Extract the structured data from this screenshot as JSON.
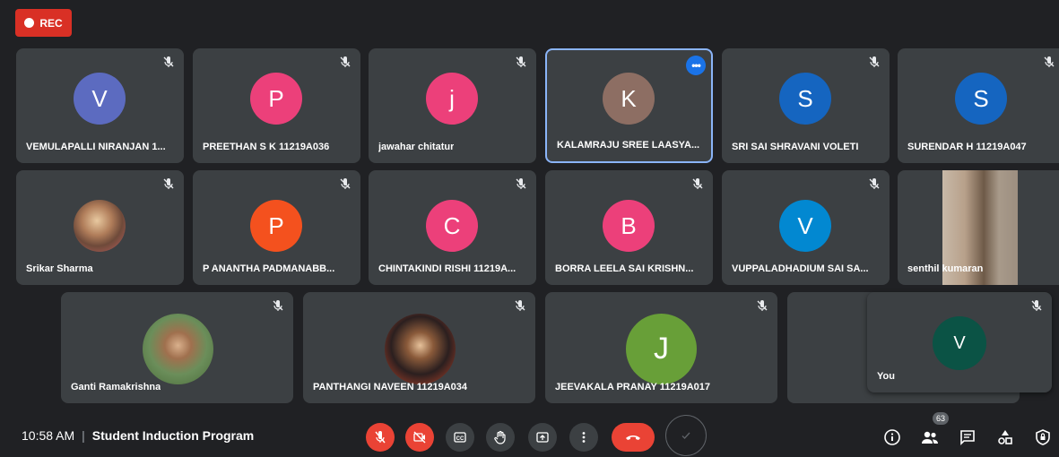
{
  "recording": {
    "label": "REC"
  },
  "participants": [
    {
      "name": "VEMULAPALLI NIRANJAN 1...",
      "initial": "V",
      "color": "#5c6bc0"
    },
    {
      "name": "PREETHAN S K 11219A036",
      "initial": "P",
      "color": "#ec407a"
    },
    {
      "name": "jawahar chitatur",
      "initial": "j",
      "color": "#ec407a"
    },
    {
      "name": "KALAMRAJU SREE LAASYA...",
      "initial": "K",
      "color": "#8d6e63"
    },
    {
      "name": "SRI SAI SHRAVANI VOLETI",
      "initial": "S",
      "color": "#1565c0"
    },
    {
      "name": "SURENDAR H 11219A047",
      "initial": "S",
      "color": "#1565c0"
    },
    {
      "name": "Srikar Sharma",
      "initial": "",
      "color": "#c19a6b"
    },
    {
      "name": "P ANANTHA PADMANABB...",
      "initial": "P",
      "color": "#f4511e"
    },
    {
      "name": "CHINTAKINDI RISHI 11219A...",
      "initial": "C",
      "color": "#ec407a"
    },
    {
      "name": "BORRA LEELA SAI KRISHN...",
      "initial": "B",
      "color": "#ec407a"
    },
    {
      "name": "VUPPALADHADIUM SAI SA...",
      "initial": "V",
      "color": "#0288d1"
    },
    {
      "name": "senthil kumaran",
      "initial": "",
      "color": "#8b7a6b"
    },
    {
      "name": "Ganti Ramakrishna",
      "initial": "",
      "color": "#6b8e5a"
    },
    {
      "name": "PANTHANGI NAVEEN 11219A034",
      "initial": "",
      "color": "#3b2a2a"
    },
    {
      "name": "JEEVAKALA PRANAY 11219A017",
      "initial": "J",
      "color": "#689f38"
    }
  ],
  "self_view": {
    "name": "You",
    "initial": "V",
    "color": "#0b5345"
  },
  "bottom_bar": {
    "time": "10:58 AM",
    "separator": "|",
    "meeting_title": "Student Induction Program",
    "people_count": "63"
  },
  "icons": {
    "mute": "mic-off-icon",
    "more": "more-options-icon",
    "info": "info-icon",
    "people": "people-icon",
    "chat": "chat-icon",
    "activities": "activities-icon",
    "host": "host-controls-icon"
  }
}
